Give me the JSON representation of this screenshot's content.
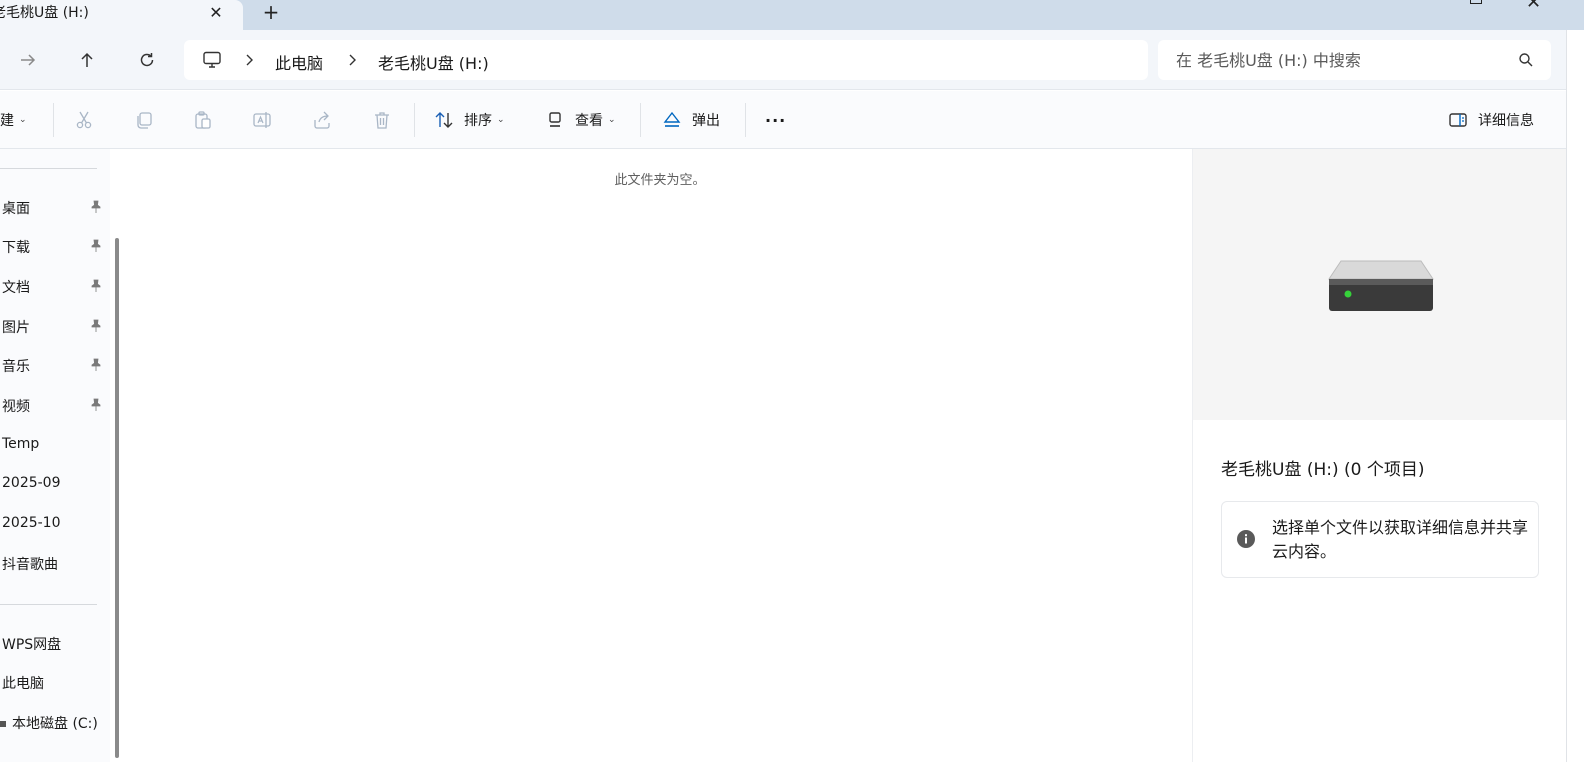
{
  "tab": {
    "title": "老毛桃U盘 (H:)",
    "close_symbol": "✕",
    "new_tab_symbol": "+"
  },
  "nav": {
    "breadcrumb": [
      "此电脑",
      "老毛桃U盘 (H:)"
    ],
    "search_placeholder": "在 老毛桃U盘 (H:) 中搜索"
  },
  "toolbar": {
    "new_label": "建",
    "sort_label": "排序",
    "view_label": "查看",
    "eject_label": "弹出",
    "more_label": "···",
    "details_label": "详细信息",
    "caret": "⌄"
  },
  "sidebar": {
    "pinned": [
      {
        "label": "桌面"
      },
      {
        "label": "下载"
      },
      {
        "label": "文档"
      },
      {
        "label": "图片"
      },
      {
        "label": "音乐"
      },
      {
        "label": "视频"
      }
    ],
    "folders": [
      {
        "label": "Temp"
      },
      {
        "label": "2025-09"
      },
      {
        "label": "2025-10"
      },
      {
        "label": "抖音歌曲"
      }
    ],
    "locations": [
      {
        "label": "WPS网盘"
      },
      {
        "label": "此电脑"
      },
      {
        "label": "本地磁盘 (C:)"
      }
    ]
  },
  "content": {
    "empty_message": "此文件夹为空。"
  },
  "details": {
    "title": "老毛桃U盘 (H:) (0 个项目)",
    "info_text": "选择单个文件以获取详细信息并共享云内容。"
  },
  "colors": {
    "accent": "#0067c0",
    "titlebar": "#cfdcea",
    "drive_led": "#36d23a"
  }
}
